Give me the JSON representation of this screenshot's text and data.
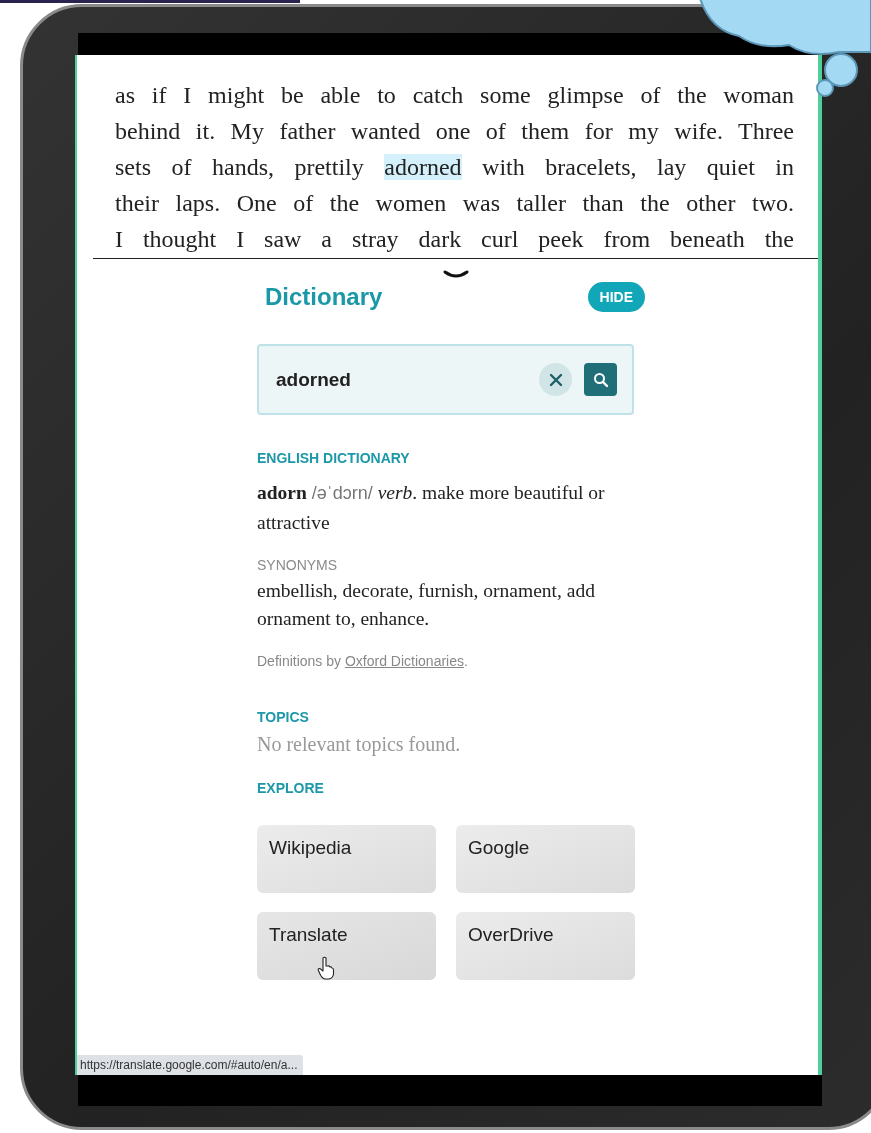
{
  "passage": {
    "lines": [
      [
        {
          "text": "as if I might be able to catch some glimpse of the woman",
          "selected": false
        }
      ],
      [
        {
          "text": "behind it. My father wanted one of them for my wife. Three",
          "selected": false
        }
      ],
      [
        {
          "text": "sets of hands, prettily ",
          "selected": false
        },
        {
          "text": "adorned",
          "selected": true
        },
        {
          "text": " with bracelets, lay quiet in",
          "selected": false
        }
      ],
      [
        {
          "text": "their laps. One of the women was taller than the other two.",
          "selected": false
        }
      ],
      [
        {
          "text": "I thought I saw a stray dark curl peek from beneath the",
          "selected": false
        }
      ]
    ]
  },
  "dictionary": {
    "title": "Dictionary",
    "hide_button": "HIDE",
    "search": {
      "value": "adorned"
    },
    "english_heading": "ENGLISH DICTIONARY",
    "entry": {
      "headword": "adorn",
      "pronunciation": "/əˈdɔrn/",
      "part_of_speech": "verb",
      "definition": ". make more beautiful or attractive"
    },
    "synonyms_label": "SYNONYMS",
    "synonyms": "embellish, decorate, furnish, ornament, add ornament to, enhance.",
    "attribution": {
      "before": "Definitions by ",
      "link": "Oxford Dictionaries",
      "after": "."
    },
    "topics_heading": "TOPICS",
    "topics_text": "No relevant topics found.",
    "explore_heading": "EXPLORE",
    "explore_buttons": [
      {
        "label": "Wikipedia",
        "hovered": false
      },
      {
        "label": "Google",
        "hovered": false
      },
      {
        "label": "Translate",
        "hovered": true
      },
      {
        "label": "OverDrive",
        "hovered": false
      }
    ]
  },
  "status_url": "https://translate.google.com/#auto/en/a..."
}
